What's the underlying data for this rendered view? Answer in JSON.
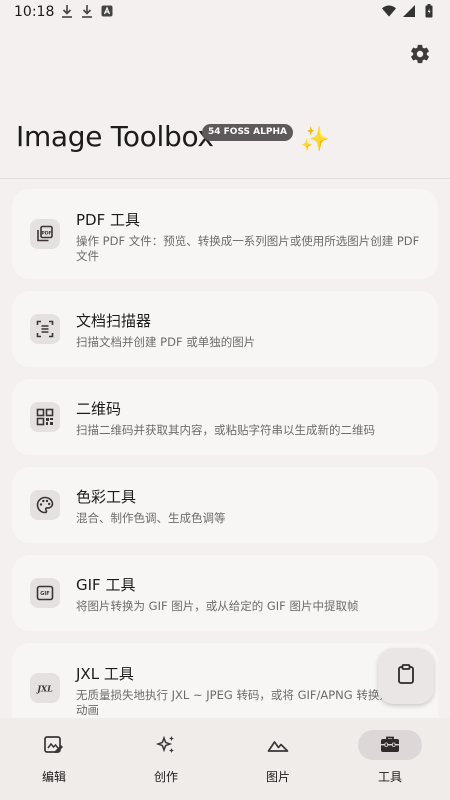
{
  "status_bar": {
    "time": "10:18",
    "left_icons": [
      "download-icon",
      "download-icon",
      "app-a-icon"
    ],
    "right_icons": [
      "wifi-icon",
      "signal-icon",
      "battery-icon"
    ]
  },
  "header": {
    "title": "Image Toolbox",
    "badge": "54 FOSS  ALPHA",
    "settings_icon": "gear-icon",
    "sparkle": "✨"
  },
  "tools": [
    {
      "icon": "pdf-icon",
      "title": "PDF 工具",
      "desc": "操作 PDF 文件：预览、转换成一系列图片或使用所选图片创建 PDF 文件"
    },
    {
      "icon": "document-scanner-icon",
      "title": "文档扫描器",
      "desc": "扫描文档并创建 PDF 或单独的图片"
    },
    {
      "icon": "qr-code-icon",
      "title": "二维码",
      "desc": "扫描二维码并获取其内容，或粘贴字符串以生成新的二维码"
    },
    {
      "icon": "palette-icon",
      "title": "色彩工具",
      "desc": "混合、制作色调、生成色调等"
    },
    {
      "icon": "gif-icon",
      "title": "GIF 工具",
      "desc": "将图片转换为 GIF 图片，或从给定的 GIF 图片中提取帧"
    },
    {
      "icon": "jxl-icon",
      "title": "JXL 工具",
      "desc": "无质量损失地执行 JXL ~ JPEG 转码，或将 GIF/APNG 转换为 JXL 动画"
    }
  ],
  "fab": {
    "icon": "clipboard-icon"
  },
  "bottom_nav": [
    {
      "label": "编辑",
      "icon": "edit-image-icon",
      "active": false
    },
    {
      "label": "创作",
      "icon": "sparkles-icon",
      "active": false
    },
    {
      "label": "图片",
      "icon": "landscape-icon",
      "active": false
    },
    {
      "label": "工具",
      "icon": "toolbox-icon",
      "active": true
    }
  ],
  "colors": {
    "background": "#f3f0ef",
    "card": "#f8f6f5",
    "badge": "#5e5a5b",
    "active_nav": "#ddd8d7"
  }
}
